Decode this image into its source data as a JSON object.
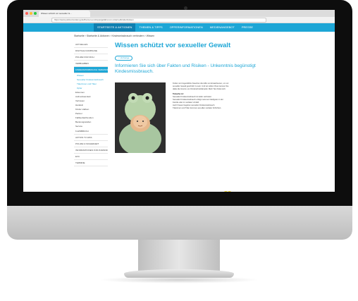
{
  "browser": {
    "tab_title": "Wissen schützt vor sexueller G...",
    "url": "https://www.polizei-beratung.de/themen-und-tipps/gefahren-im-internet/kinder/wissen",
    "dot_colors": [
      "#ff5f56",
      "#ffbd2e",
      "#27c93f"
    ]
  },
  "topnav": {
    "items": [
      "STARTSEITE & AKTIONEN",
      "THEMEN & TIPPS",
      "OPFERINFORMATIONEN",
      "MEDIENANGEBOT",
      "PRESSE"
    ]
  },
  "breadcrumb": "Startseite › Startseite & Aktionen › Kindesmissbrauch verhindern › Wissen",
  "sidebar": {
    "items": [
      "AKTUELLES",
      "DIGITALE KAMPAGNE",
      "POLIZEI FÜR DICH",
      "VERBLEIBEN"
    ],
    "highlight": "KINDESMISSBRAUCH VERHINDERN",
    "subitems": [
      "Wissen",
      "Sexueller Kindesmissbrauch",
      "Täterinnen und Täter",
      "Opfer"
    ],
    "subitems2": [
      "Erkennen",
      "Aufmerksamkeit",
      "Vertrauen",
      "Handeln",
      "Kinder stärken",
      "Partner",
      "Fallbeobachtenden",
      "Beratungsstellen",
      "Service"
    ],
    "items_after": [
      "K-EINBRUCH",
      "AKTION TU WAS",
      "POLIZEI & SICHERHEIT",
      "INFORMATIONEN FÜR ZUWANDERER",
      "EVC",
      "TERMINE"
    ]
  },
  "main": {
    "title": "Wissen schützt vor sexueller Gewalt",
    "back_button": "< Vorherige",
    "subtitle": "Informieren Sie sich über Fakten und Risiken - Unkenntnis begünstigt Kindesmissbrauch.",
    "paragraph": "Kinder und Jugendliche brauchen die Hilfe von Erwachsenen, um vor sexueller Gewalt geschützt zu sein. Und wir sollten Ihnen kennen Sie dabei die Grenze von Kinderschutzkämpfer. Mehr Text findet sich.",
    "facts_heading": "Tatsache ist:",
    "facts": [
      "Sexueller Kindesmissbrauch ist leider verbreitet.",
      "Sexueller Kindesmissbrauch erfolgt meist am häufigsten in der Familie oder im sozialen Umfeld.",
      "Auch Frauen begehen sexuellen Kindesmissbrauch.",
      "Täterinnen und Täter kommen aus allen sozialen Schichten."
    ],
    "heart_color": "#f5d833"
  }
}
